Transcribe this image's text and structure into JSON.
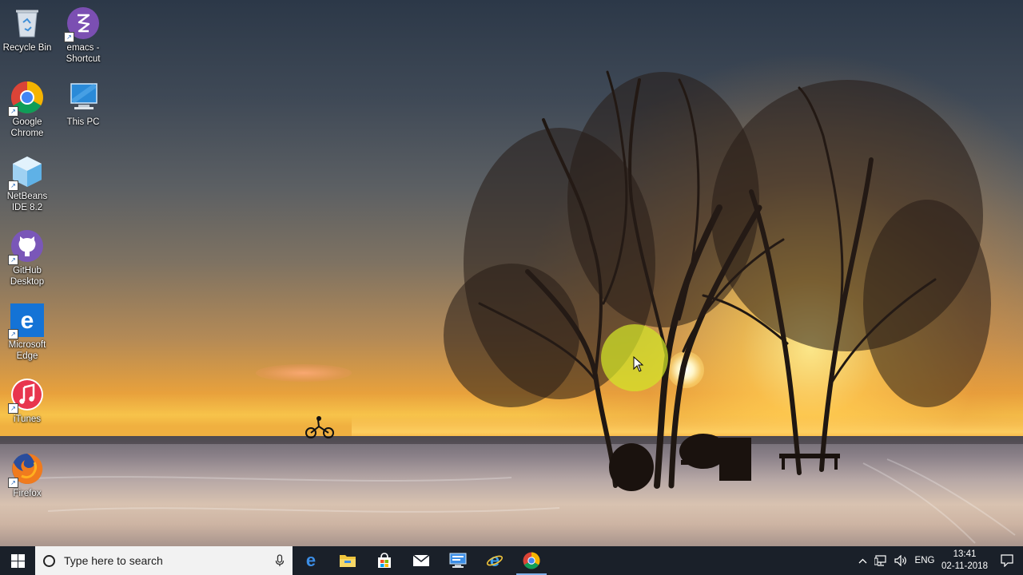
{
  "desktop": {
    "icons": [
      {
        "label": "Recycle Bin",
        "icon": "recycle-bin-icon"
      },
      {
        "label": "emacs - Shortcut",
        "icon": "emacs-icon"
      },
      {
        "label": "Google Chrome",
        "icon": "chrome-icon"
      },
      {
        "label": "This PC",
        "icon": "this-pc-icon"
      },
      {
        "label": "NetBeans IDE 8.2",
        "icon": "netbeans-icon"
      },
      {
        "label": "GitHub Desktop",
        "icon": "github-desktop-icon"
      },
      {
        "label": "Microsoft Edge",
        "icon": "edge-icon"
      },
      {
        "label": "iTunes",
        "icon": "itunes-icon"
      },
      {
        "label": "Firefox",
        "icon": "firefox-icon"
      }
    ]
  },
  "taskbar": {
    "search_placeholder": "Type here to search",
    "apps": [
      {
        "icon": "edge-icon"
      },
      {
        "icon": "file-explorer-icon"
      },
      {
        "icon": "store-icon"
      },
      {
        "icon": "mail-icon"
      },
      {
        "icon": "remote-desktop-icon"
      },
      {
        "icon": "internet-explorer-icon"
      },
      {
        "icon": "chrome-icon",
        "active": true
      }
    ],
    "tray": {
      "language": "ENG",
      "time": "13:41",
      "date": "02-11-2018"
    }
  },
  "colors": {
    "taskbar": "#1a2029",
    "search_box": "#f2f2f2",
    "cursor_highlight": "#d2e628"
  }
}
